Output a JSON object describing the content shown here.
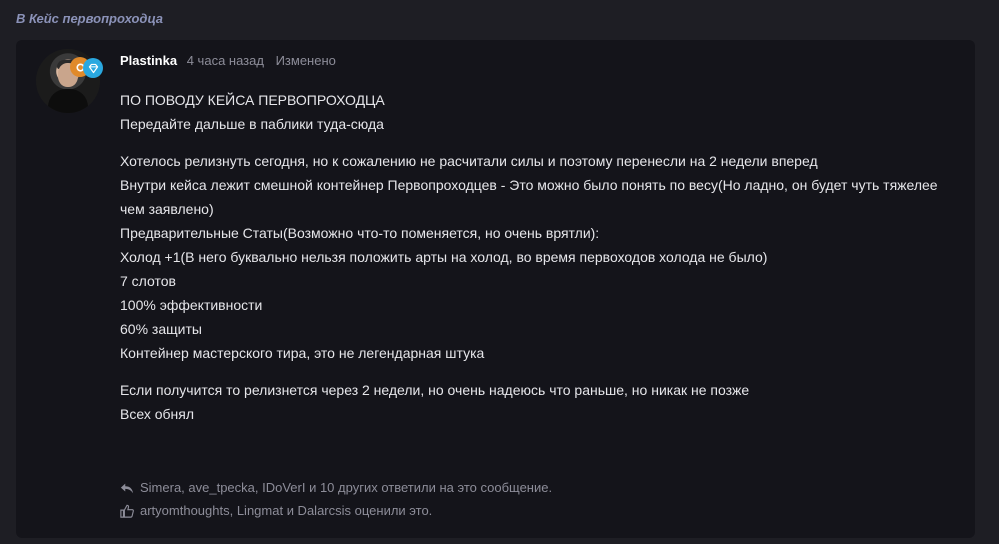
{
  "thread": {
    "title": "В Кейс первопроходца"
  },
  "post": {
    "username": "Plastinka",
    "time": "4 часа назад",
    "edited": "Изменено",
    "body": [
      "ПО ПОВОДУ КЕЙСА ПЕРВОПРОХОДЦА",
      "Передайте дальше в паблики туда-сюда",
      "",
      "Хотелось релизнуть сегодня, но к сожалению не расчитали силы и поэтому перенесли на 2 недели вперед",
      "Внутри кейса лежит смешной контейнер Первопроходцев - Это можно было понять по весу(Но ладно, он будет чуть тяжелее",
      "чем заявлено)",
      "Предварительные Статы(Возможно что-то поменяется, но очень врятли):",
      "Холод +1(В него буквально нельзя положить арты на холод, во время первоходов холода не было)",
      "7 слотов",
      "100% эффективности",
      "60% защиты",
      "Контейнер мастерского тира, это не легендарная штука",
      "",
      "Если получится то релизнется через 2 недели, но очень надеюсь что раньше, но никак не позже",
      "Всех обнял"
    ],
    "replies": "Simera, ave_tpecka, IDoVerI и 10 других ответили на это сообщение.",
    "likes": "artyomthoughts, Lingmat и Dalarcsis оценили это."
  },
  "colors": {
    "background": "#1e1e24",
    "post_background": "#14141a",
    "link": "#8b92b8",
    "muted": "#8d8d99",
    "badge_orange": "#e08a2a",
    "badge_blue": "#2aa8e0"
  },
  "icons": {
    "reply": "reply-arrow-icon",
    "like": "thumbs-up-icon",
    "badge_1": "trophy-badge-icon",
    "badge_2": "diamond-badge-icon"
  }
}
